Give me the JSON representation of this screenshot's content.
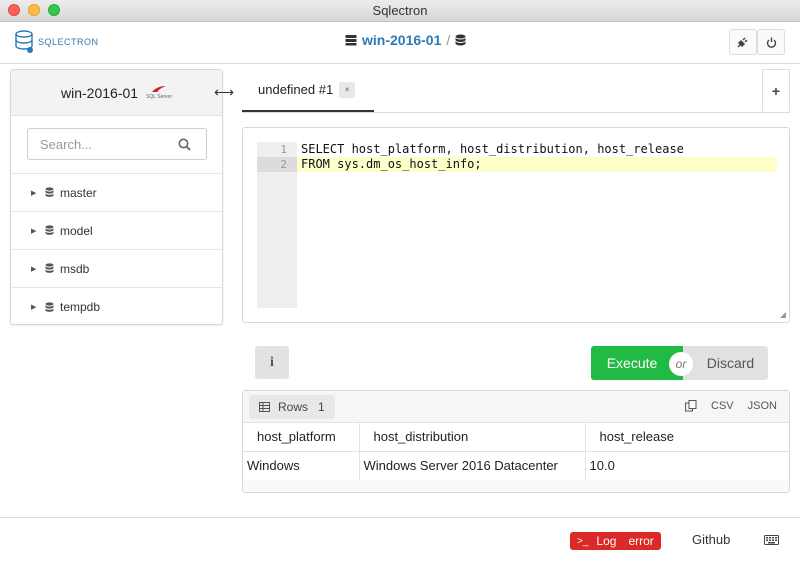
{
  "window": {
    "title": "Sqlectron"
  },
  "header": {
    "logo_text": "SQLECTRON",
    "connection_name": "win-2016-01",
    "separator": "/",
    "plug_icon": "plug-icon",
    "power_icon": "power-icon"
  },
  "sidebar": {
    "server_name": "win-2016-01",
    "server_type_label": "SQL Server",
    "search_placeholder": "Search...",
    "databases": [
      "master",
      "model",
      "msdb",
      "tempdb"
    ]
  },
  "tabs": {
    "items": [
      {
        "label": "undefined #1",
        "close": "×"
      }
    ],
    "add_label": "+"
  },
  "editor": {
    "lines": [
      {
        "number": "1",
        "text": "SELECT host_platform, host_distribution, host_release"
      },
      {
        "number": "2",
        "text": "FROM sys.dm_os_host_info;"
      }
    ]
  },
  "actions": {
    "info_label": "i",
    "execute_label": "Execute",
    "or_label": "or",
    "discard_label": "Discard"
  },
  "results": {
    "rows_label": "Rows",
    "rows_count": "1",
    "csv_label": "CSV",
    "json_label": "JSON",
    "columns": [
      "host_platform",
      "host_distribution",
      "host_release"
    ],
    "rows": [
      [
        "Windows",
        "Windows Server 2016 Datacenter",
        "10.0"
      ]
    ]
  },
  "footer": {
    "log_prompt": ">_",
    "log_label": "Log",
    "error_label": "error",
    "github_label": "Github"
  },
  "colors": {
    "accent": "#2a7bb6",
    "execute": "#21ba45",
    "error": "#db2828"
  }
}
